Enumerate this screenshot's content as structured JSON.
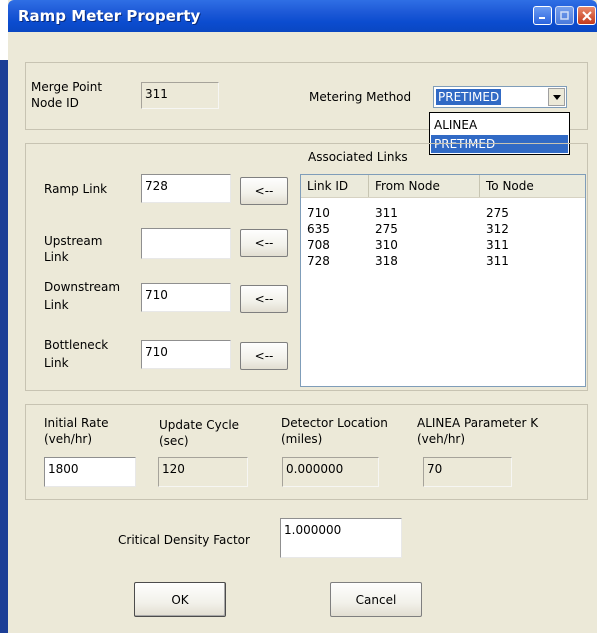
{
  "window": {
    "title": "Ramp Meter Property"
  },
  "merge_point": {
    "label_line1": "Merge Point",
    "label_line2": "Node ID",
    "value": "311"
  },
  "metering_method": {
    "label": "Metering Method",
    "selected": "PRETIMED",
    "options": [
      "ALINEA",
      "PRETIMED"
    ]
  },
  "associated_links": {
    "label": "Associated Links",
    "columns": [
      "Link ID",
      "From Node",
      "To Node"
    ],
    "rows": [
      [
        "710",
        "311",
        "275"
      ],
      [
        "635",
        "275",
        "312"
      ],
      [
        "708",
        "310",
        "311"
      ],
      [
        "728",
        "318",
        "311"
      ]
    ]
  },
  "links": {
    "ramp": {
      "label": "Ramp Link",
      "value": "728",
      "button": "<--"
    },
    "upstream": {
      "label_line1": "Upstream",
      "label_line2": "Link",
      "value": "",
      "button": "<--"
    },
    "downstream": {
      "label_line1": "Downstream",
      "label_line2": "Link",
      "value": "710",
      "button": "<--"
    },
    "bottleneck": {
      "label_line1": "Bottleneck",
      "label_line2": "Link",
      "value": "710",
      "button": "<--"
    }
  },
  "parameters": {
    "initial_rate": {
      "label_line1": "Initial Rate",
      "label_line2": "(veh/hr)",
      "value": "1800"
    },
    "update_cycle": {
      "label_line1": "Update Cycle",
      "label_line2": "(sec)",
      "value": "120"
    },
    "detector_location": {
      "label_line1": "Detector Location",
      "label_line2": "(miles)",
      "value": "0.000000"
    },
    "alinea_k": {
      "label_line1": "ALINEA Parameter K",
      "label_line2": "(veh/hr)",
      "value": "70"
    }
  },
  "critical_density": {
    "label": "Critical Density Factor",
    "value": "1.000000"
  },
  "buttons": {
    "ok": "OK",
    "cancel": "Cancel"
  },
  "colors": {
    "titlebar": "#0a47c2",
    "dialog_bg": "#ece9d8",
    "selection": "#316ac5"
  }
}
